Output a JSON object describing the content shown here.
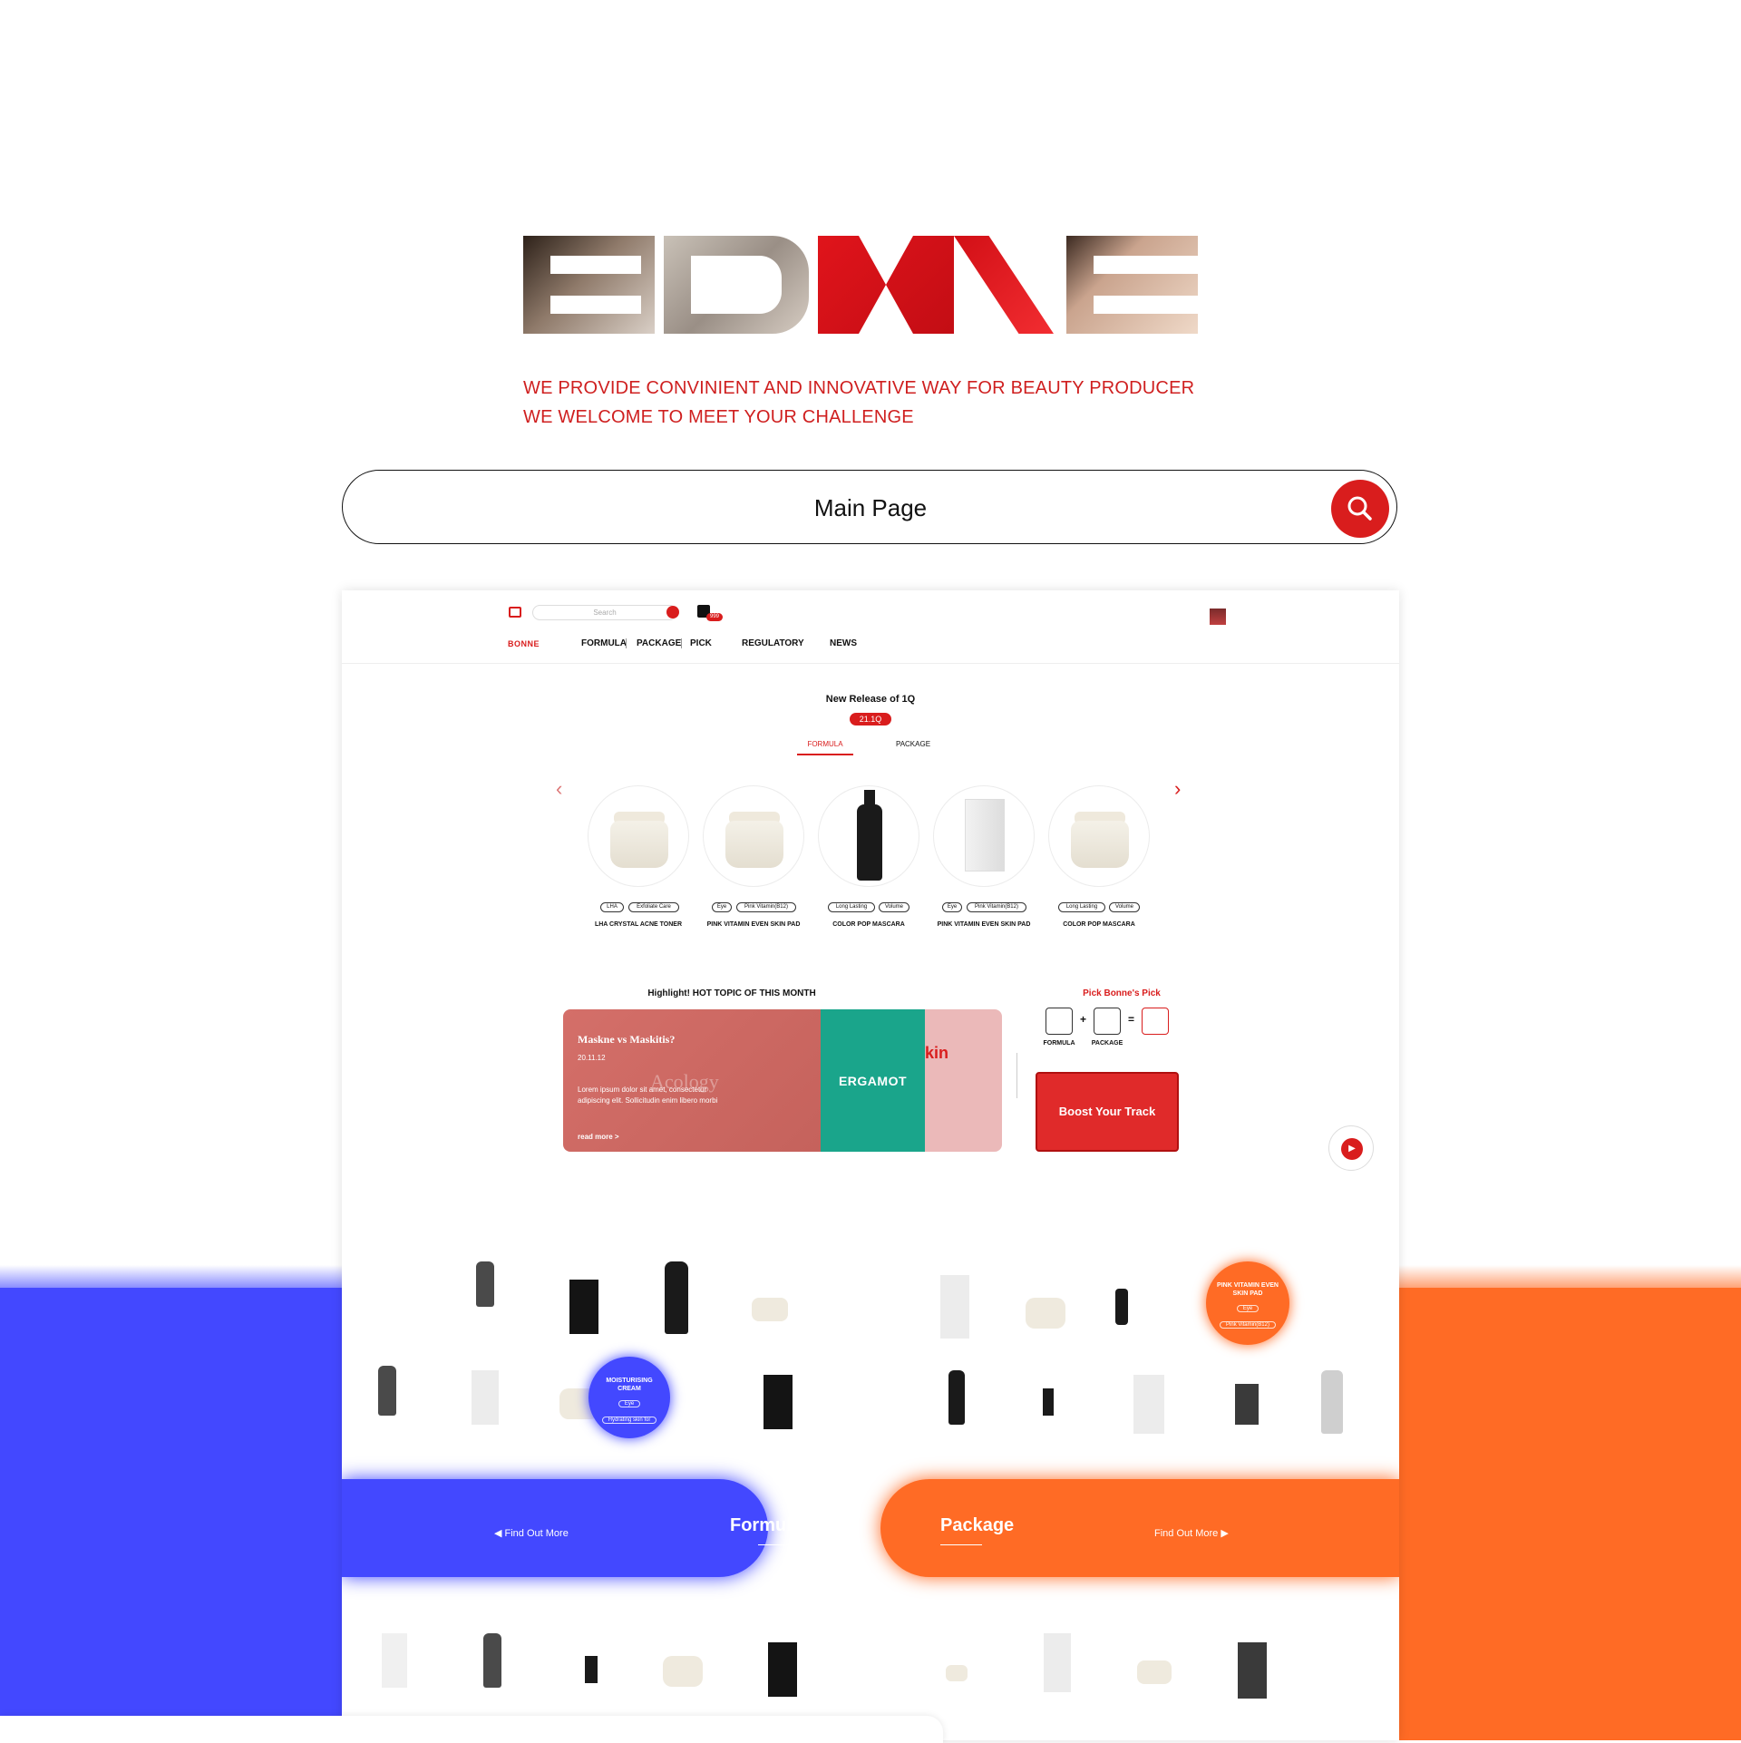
{
  "hero": {
    "logo_text": "BONNE",
    "tagline_1": "WE PROVIDE CONVINIENT AND INNOVATIVE WAY FOR BEAUTY PRODUCER",
    "tagline_2": "WE WELCOME TO MEET YOUR CHALLENGE"
  },
  "search": {
    "value": "Main Page",
    "button_icon": "search-icon"
  },
  "colors": {
    "brand_red": "#d91d1d",
    "formula_blue": "#4348ff",
    "package_orange": "#ff6b25"
  },
  "preview": {
    "header": {
      "search_placeholder": "Search",
      "cart_count": "999",
      "brand": "BONNE",
      "nav": [
        "FORMULA",
        "PACKAGE",
        "PICK",
        "REGULATORY",
        "NEWS"
      ]
    },
    "release": {
      "title": "New Release of 1Q",
      "badge": "21.1Q",
      "tabs": [
        "FORMULA",
        "PACKAGE"
      ],
      "active_tab": "FORMULA",
      "products": [
        {
          "name": "LHA CRYSTAL ACNE TONER",
          "tags": [
            "LHA",
            "Exfoliate Care"
          ],
          "kind": "jar"
        },
        {
          "name": "PINK VITAMIN EVEN SKIN PAD",
          "tags": [
            "Eye",
            "Pink Vitamin(B12)"
          ],
          "kind": "jar"
        },
        {
          "name": "COLOR POP MASCARA",
          "tags": [
            "Long Lasting",
            "Volume"
          ],
          "kind": "bottle"
        },
        {
          "name": "PINK VITAMIN EVEN SKIN PAD",
          "tags": [
            "Eye",
            "Pink Vitamin(B12)"
          ],
          "kind": "box"
        },
        {
          "name": "COLOR POP MASCARA",
          "tags": [
            "Long Lasting",
            "Volume"
          ],
          "kind": "jar"
        }
      ]
    },
    "highlight": {
      "title": "Highlight! HOT TOPIC OF THIS MONTH",
      "headline": "Maskne vs Maskitis?",
      "date": "20.11.12",
      "body": "Lorem ipsum dolor sit amet, consectetur adipiscing elit. Sollicitudin enim libero morbi",
      "more": "read more  >",
      "watermark": "Acology",
      "card2_text": "ERGAMOT",
      "card3_text": "kin"
    },
    "pick": {
      "title": "Pick Bonne's Pick",
      "labels": [
        "FORMULA",
        "PACKAGE"
      ],
      "cta": "Boost Your Track"
    },
    "bubbles": {
      "blue_title": "MOISTURISING CREAM",
      "blue_tags": [
        "Eye",
        "Hydrating skin for"
      ],
      "orange_title": "PINK VITAMIN EVEN SKIN PAD",
      "orange_tags": [
        "Eye",
        "Pink Vitamin(B12)"
      ]
    },
    "bands": {
      "formula_title": "Formula",
      "formula_link": "Find Out More",
      "package_title": "Package",
      "package_link": "Find Out More"
    }
  }
}
